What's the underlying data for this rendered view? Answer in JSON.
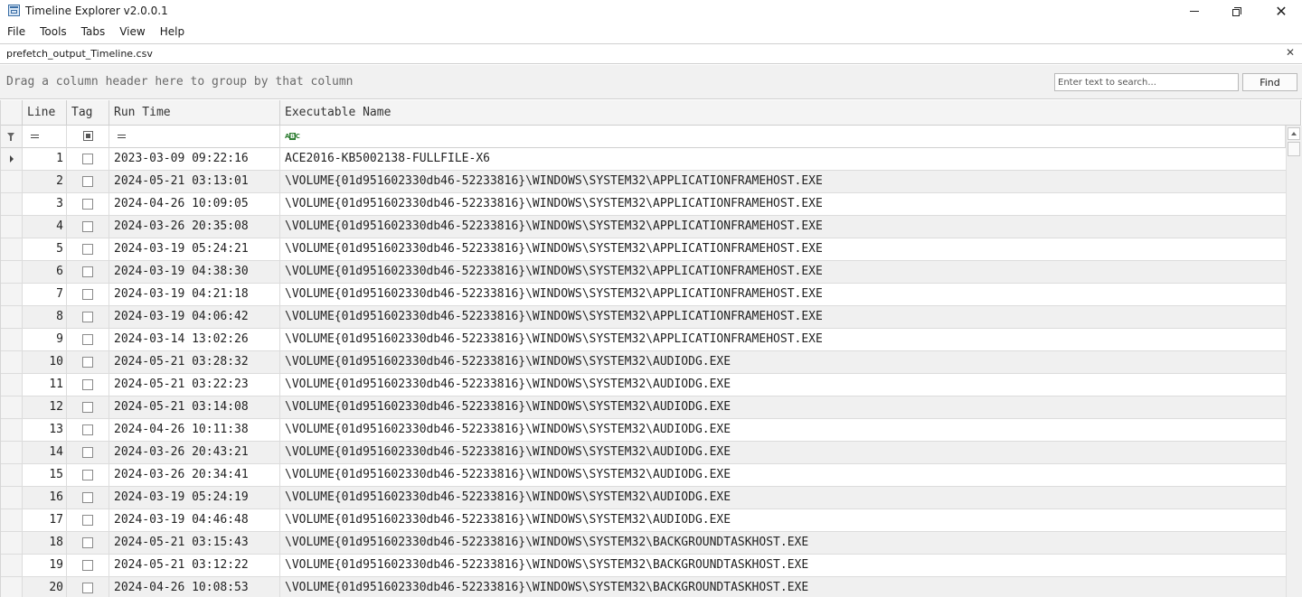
{
  "window": {
    "title": "Timeline Explorer v2.0.0.1"
  },
  "menu": [
    "File",
    "Tools",
    "Tabs",
    "View",
    "Help"
  ],
  "tab": {
    "label": "prefetch_output_Timeline.csv"
  },
  "group_panel": {
    "hint": "Drag a column header here to group by that column"
  },
  "search": {
    "placeholder": "Enter text to search...",
    "find_label": "Find"
  },
  "columns": [
    "Line",
    "Tag",
    "Run Time",
    "Executable Name"
  ],
  "rows": [
    {
      "line": "1",
      "run_time": "2023-03-09 09:22:16",
      "exe": "ACE2016-KB5002138-FULLFILE-X6"
    },
    {
      "line": "2",
      "run_time": "2024-05-21 03:13:01",
      "exe": "\\VOLUME{01d951602330db46-52233816}\\WINDOWS\\SYSTEM32\\APPLICATIONFRAMEHOST.EXE"
    },
    {
      "line": "3",
      "run_time": "2024-04-26 10:09:05",
      "exe": "\\VOLUME{01d951602330db46-52233816}\\WINDOWS\\SYSTEM32\\APPLICATIONFRAMEHOST.EXE"
    },
    {
      "line": "4",
      "run_time": "2024-03-26 20:35:08",
      "exe": "\\VOLUME{01d951602330db46-52233816}\\WINDOWS\\SYSTEM32\\APPLICATIONFRAMEHOST.EXE"
    },
    {
      "line": "5",
      "run_time": "2024-03-19 05:24:21",
      "exe": "\\VOLUME{01d951602330db46-52233816}\\WINDOWS\\SYSTEM32\\APPLICATIONFRAMEHOST.EXE"
    },
    {
      "line": "6",
      "run_time": "2024-03-19 04:38:30",
      "exe": "\\VOLUME{01d951602330db46-52233816}\\WINDOWS\\SYSTEM32\\APPLICATIONFRAMEHOST.EXE"
    },
    {
      "line": "7",
      "run_time": "2024-03-19 04:21:18",
      "exe": "\\VOLUME{01d951602330db46-52233816}\\WINDOWS\\SYSTEM32\\APPLICATIONFRAMEHOST.EXE"
    },
    {
      "line": "8",
      "run_time": "2024-03-19 04:06:42",
      "exe": "\\VOLUME{01d951602330db46-52233816}\\WINDOWS\\SYSTEM32\\APPLICATIONFRAMEHOST.EXE"
    },
    {
      "line": "9",
      "run_time": "2024-03-14 13:02:26",
      "exe": "\\VOLUME{01d951602330db46-52233816}\\WINDOWS\\SYSTEM32\\APPLICATIONFRAMEHOST.EXE"
    },
    {
      "line": "10",
      "run_time": "2024-05-21 03:28:32",
      "exe": "\\VOLUME{01d951602330db46-52233816}\\WINDOWS\\SYSTEM32\\AUDIODG.EXE"
    },
    {
      "line": "11",
      "run_time": "2024-05-21 03:22:23",
      "exe": "\\VOLUME{01d951602330db46-52233816}\\WINDOWS\\SYSTEM32\\AUDIODG.EXE"
    },
    {
      "line": "12",
      "run_time": "2024-05-21 03:14:08",
      "exe": "\\VOLUME{01d951602330db46-52233816}\\WINDOWS\\SYSTEM32\\AUDIODG.EXE"
    },
    {
      "line": "13",
      "run_time": "2024-04-26 10:11:38",
      "exe": "\\VOLUME{01d951602330db46-52233816}\\WINDOWS\\SYSTEM32\\AUDIODG.EXE"
    },
    {
      "line": "14",
      "run_time": "2024-03-26 20:43:21",
      "exe": "\\VOLUME{01d951602330db46-52233816}\\WINDOWS\\SYSTEM32\\AUDIODG.EXE"
    },
    {
      "line": "15",
      "run_time": "2024-03-26 20:34:41",
      "exe": "\\VOLUME{01d951602330db46-52233816}\\WINDOWS\\SYSTEM32\\AUDIODG.EXE"
    },
    {
      "line": "16",
      "run_time": "2024-03-19 05:24:19",
      "exe": "\\VOLUME{01d951602330db46-52233816}\\WINDOWS\\SYSTEM32\\AUDIODG.EXE"
    },
    {
      "line": "17",
      "run_time": "2024-03-19 04:46:48",
      "exe": "\\VOLUME{01d951602330db46-52233816}\\WINDOWS\\SYSTEM32\\AUDIODG.EXE"
    },
    {
      "line": "18",
      "run_time": "2024-05-21 03:15:43",
      "exe": "\\VOLUME{01d951602330db46-52233816}\\WINDOWS\\SYSTEM32\\BACKGROUNDTASKHOST.EXE"
    },
    {
      "line": "19",
      "run_time": "2024-05-21 03:12:22",
      "exe": "\\VOLUME{01d951602330db46-52233816}\\WINDOWS\\SYSTEM32\\BACKGROUNDTASKHOST.EXE"
    },
    {
      "line": "20",
      "run_time": "2024-04-26 10:08:53",
      "exe": "\\VOLUME{01d951602330db46-52233816}\\WINDOWS\\SYSTEM32\\BACKGROUNDTASKHOST.EXE"
    }
  ]
}
